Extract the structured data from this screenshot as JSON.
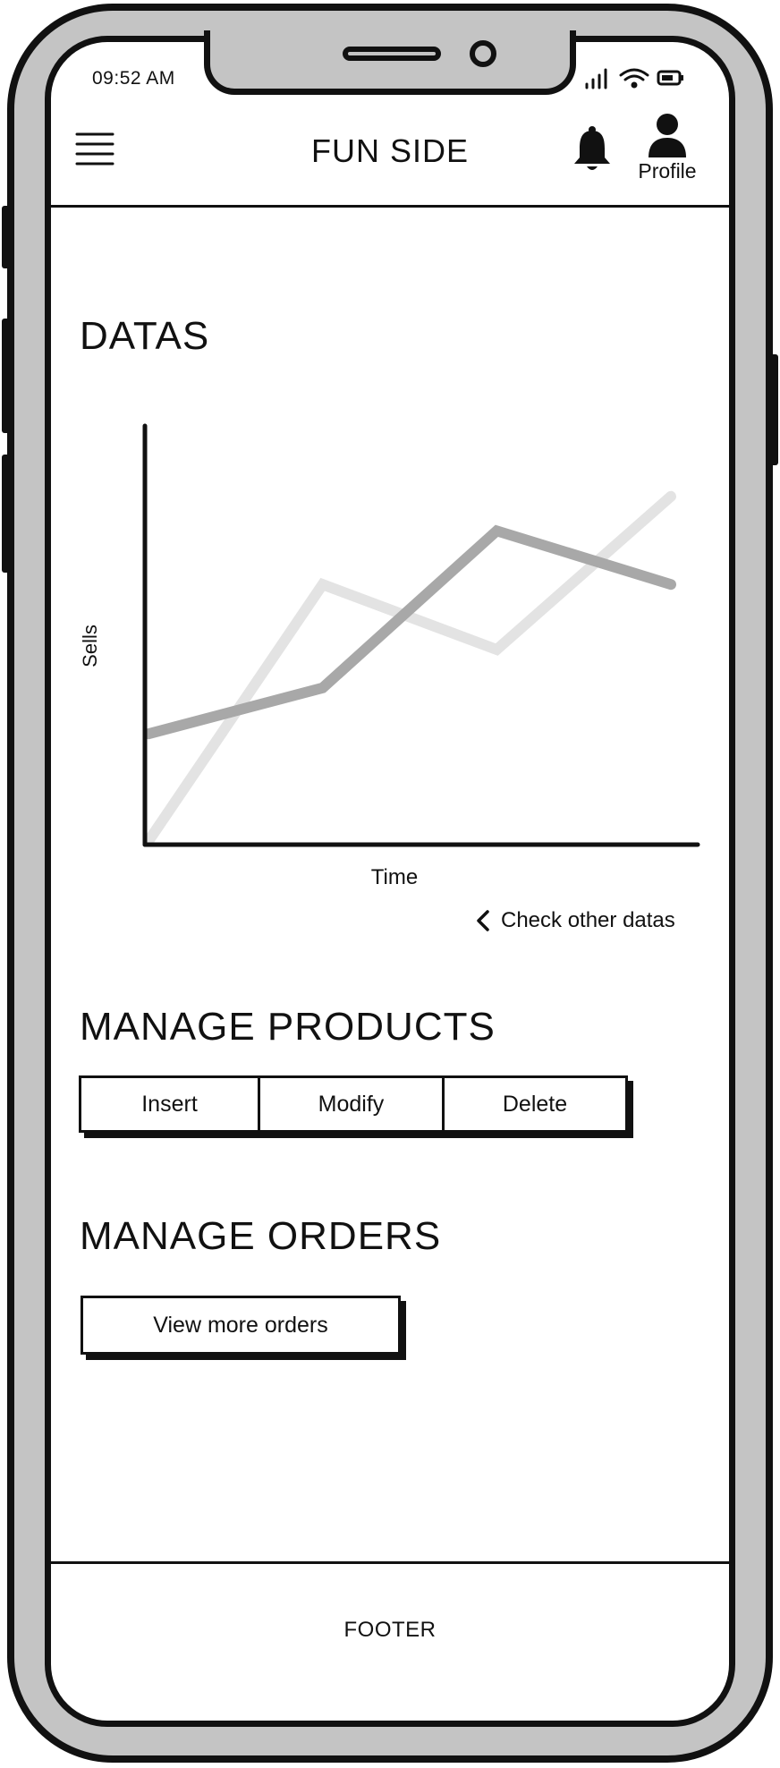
{
  "status_bar": {
    "time": "09:52 AM",
    "icons": [
      "signal-icon",
      "wifi-icon",
      "battery-icon"
    ]
  },
  "header": {
    "menu_icon": "hamburger-menu-icon",
    "title": "FUN SIDE",
    "notification_icon": "bell-icon",
    "profile_label": "Profile"
  },
  "datas_section": {
    "title": "DATAS",
    "check_link": "Check other datas"
  },
  "chart_data": {
    "type": "line",
    "xlabel": "Time",
    "ylabel": "Sells",
    "x": [
      0,
      1,
      2,
      3
    ],
    "xlim": [
      0,
      3
    ],
    "ylim": [
      0,
      100
    ],
    "grid": false,
    "legend": "none",
    "series": [
      {
        "values": [
          0,
          67,
          50,
          90
        ],
        "color": "#e3e3e3"
      },
      {
        "values": [
          28,
          40,
          81,
          67
        ],
        "color": "#a8a8a8"
      }
    ]
  },
  "products_section": {
    "title": "MANAGE PRODUCTS",
    "buttons": [
      "Insert",
      "Modify",
      "Delete"
    ]
  },
  "orders_section": {
    "title": "MANAGE ORDERS",
    "view_button": "View more orders"
  },
  "footer": {
    "text": "FOOTER"
  },
  "colors": {
    "frame": "#c4c4c4",
    "outline": "#111111",
    "screen": "#ffffff"
  }
}
